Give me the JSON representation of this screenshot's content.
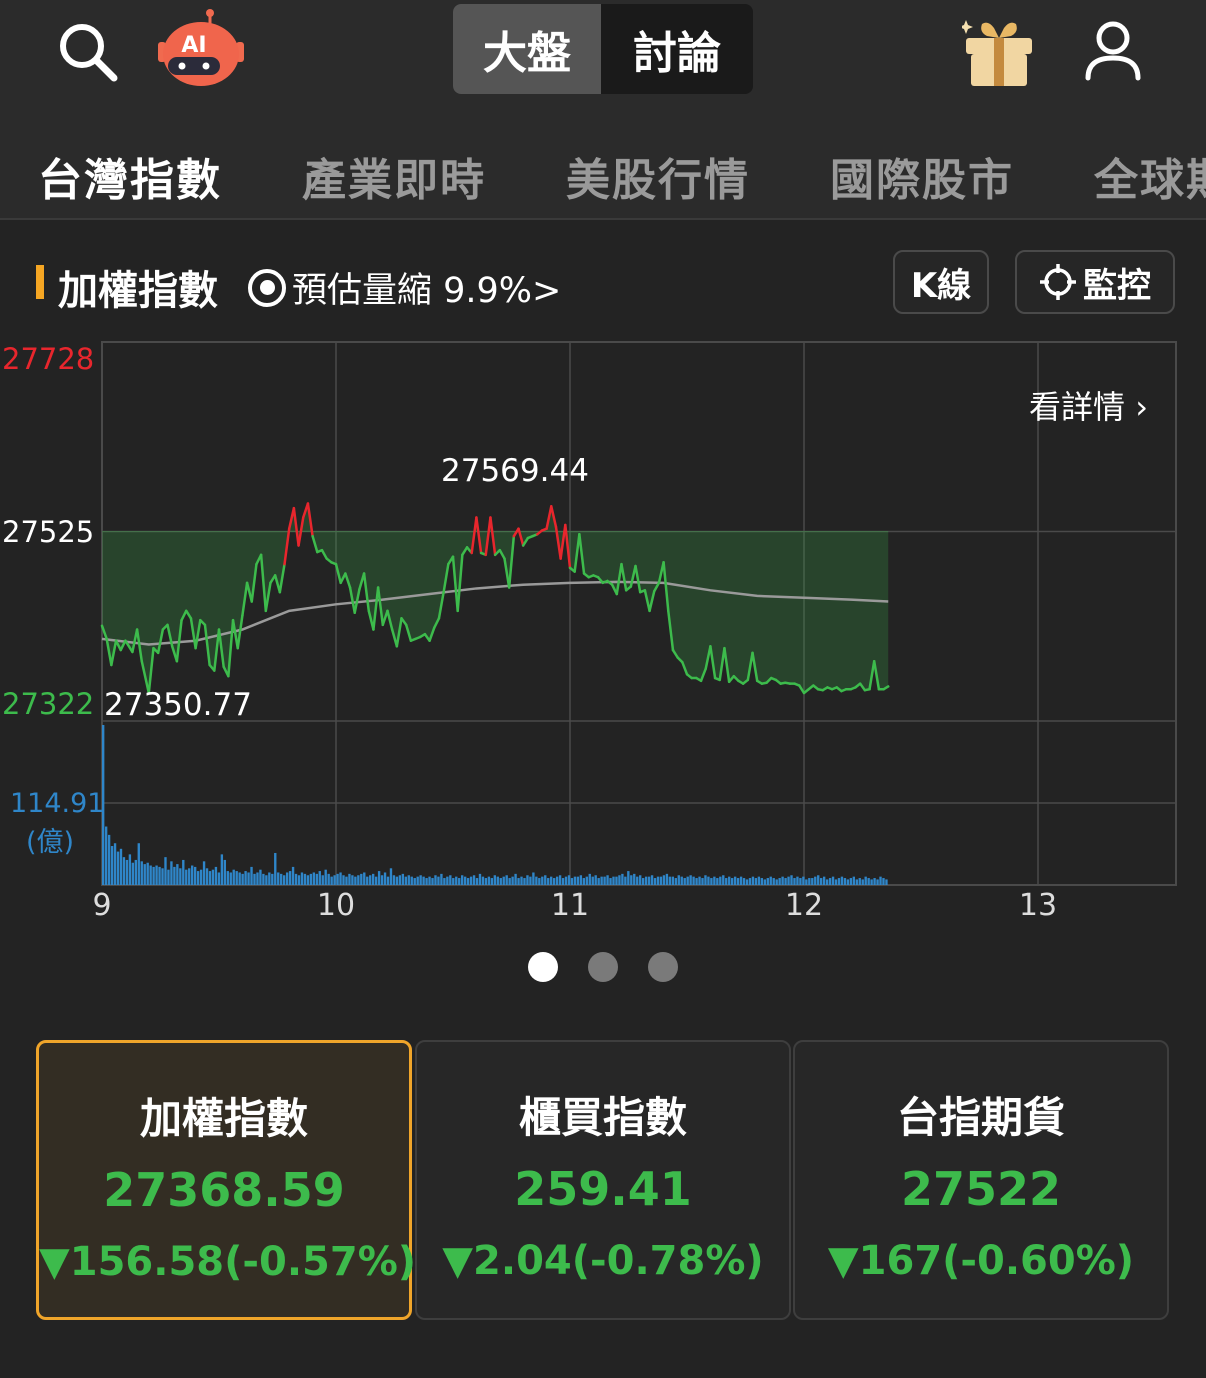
{
  "header": {
    "icons": {
      "search": "search-icon",
      "ai": "ai-robot-icon",
      "gift": "gift-icon",
      "user": "user-icon"
    },
    "ai_badge": "AI",
    "segment": {
      "active": "大盤",
      "inactive": "討論"
    }
  },
  "sub_nav": {
    "tabs": [
      "台灣指數",
      "產業即時",
      "美股行情",
      "國際股市",
      "全球期"
    ]
  },
  "index_header": {
    "title": "加權指數",
    "estimate": "預估量縮 9.9%>",
    "kline_button": "K線",
    "monitor_button": "監控"
  },
  "chart_labels": {
    "y_high": "27728",
    "y_ref": "27525",
    "y_low": "27322",
    "high_annotation": "27569.44",
    "low_annotation": "27350.77",
    "volume_max": "114.91",
    "volume_unit": "(億)",
    "detail_link": "看詳情 ›",
    "x_ticks": [
      "9",
      "10",
      "11",
      "12",
      "13"
    ]
  },
  "chart_data": {
    "type": "line",
    "ylim": [
      27322,
      27728
    ],
    "reference": 27525,
    "x_range": [
      9,
      13.5
    ],
    "price_points": [
      [
        9.0,
        27424
      ],
      [
        9.02,
        27410
      ],
      [
        9.04,
        27382
      ],
      [
        9.06,
        27408
      ],
      [
        9.08,
        27398
      ],
      [
        9.1,
        27408
      ],
      [
        9.13,
        27396
      ],
      [
        9.15,
        27420
      ],
      [
        9.17,
        27386
      ],
      [
        9.2,
        27352
      ],
      [
        9.22,
        27400
      ],
      [
        9.24,
        27395
      ],
      [
        9.26,
        27420
      ],
      [
        9.28,
        27425
      ],
      [
        9.3,
        27402
      ],
      [
        9.32,
        27386
      ],
      [
        9.34,
        27430
      ],
      [
        9.36,
        27440
      ],
      [
        9.38,
        27432
      ],
      [
        9.4,
        27400
      ],
      [
        9.42,
        27430
      ],
      [
        9.44,
        27425
      ],
      [
        9.46,
        27382
      ],
      [
        9.48,
        27376
      ],
      [
        9.5,
        27420
      ],
      [
        9.52,
        27380
      ],
      [
        9.54,
        27370
      ],
      [
        9.56,
        27430
      ],
      [
        9.58,
        27400
      ],
      [
        9.6,
        27435
      ],
      [
        9.62,
        27470
      ],
      [
        9.64,
        27450
      ],
      [
        9.66,
        27490
      ],
      [
        9.68,
        27500
      ],
      [
        9.7,
        27440
      ],
      [
        9.72,
        27470
      ],
      [
        9.74,
        27478
      ],
      [
        9.76,
        27460
      ],
      [
        9.78,
        27490
      ],
      [
        9.8,
        27528
      ],
      [
        9.82,
        27550
      ],
      [
        9.84,
        27510
      ],
      [
        9.86,
        27540
      ],
      [
        9.88,
        27555
      ],
      [
        9.9,
        27520
      ],
      [
        9.92,
        27503
      ],
      [
        9.94,
        27505
      ],
      [
        9.96,
        27496
      ],
      [
        9.98,
        27492
      ],
      [
        10.0,
        27490
      ],
      [
        10.02,
        27470
      ],
      [
        10.04,
        27480
      ],
      [
        10.06,
        27465
      ],
      [
        10.08,
        27438
      ],
      [
        10.1,
        27463
      ],
      [
        10.12,
        27480
      ],
      [
        10.14,
        27440
      ],
      [
        10.16,
        27420
      ],
      [
        10.18,
        27465
      ],
      [
        10.2,
        27425
      ],
      [
        10.22,
        27440
      ],
      [
        10.24,
        27420
      ],
      [
        10.26,
        27402
      ],
      [
        10.28,
        27432
      ],
      [
        10.3,
        27425
      ],
      [
        10.32,
        27408
      ],
      [
        10.34,
        27410
      ],
      [
        10.36,
        27412
      ],
      [
        10.38,
        27415
      ],
      [
        10.4,
        27408
      ],
      [
        10.42,
        27422
      ],
      [
        10.44,
        27432
      ],
      [
        10.46,
        27460
      ],
      [
        10.48,
        27490
      ],
      [
        10.5,
        27498
      ],
      [
        10.52,
        27440
      ],
      [
        10.54,
        27500
      ],
      [
        10.56,
        27508
      ],
      [
        10.58,
        27502
      ],
      [
        10.6,
        27540
      ],
      [
        10.62,
        27502
      ],
      [
        10.64,
        27500
      ],
      [
        10.66,
        27540
      ],
      [
        10.68,
        27500
      ],
      [
        10.7,
        27505
      ],
      [
        10.72,
        27496
      ],
      [
        10.74,
        27465
      ],
      [
        10.76,
        27520
      ],
      [
        10.78,
        27528
      ],
      [
        10.8,
        27510
      ],
      [
        10.82,
        27518
      ],
      [
        10.84,
        27520
      ],
      [
        10.86,
        27522
      ],
      [
        10.88,
        27526
      ],
      [
        10.9,
        27528
      ],
      [
        10.92,
        27552
      ],
      [
        10.94,
        27530
      ],
      [
        10.96,
        27496
      ],
      [
        10.98,
        27532
      ],
      [
        11.0,
        27486
      ],
      [
        11.02,
        27482
      ],
      [
        11.04,
        27522
      ],
      [
        11.06,
        27480
      ],
      [
        11.08,
        27476
      ],
      [
        11.1,
        27478
      ],
      [
        11.12,
        27476
      ],
      [
        11.14,
        27470
      ],
      [
        11.16,
        27472
      ],
      [
        11.18,
        27468
      ],
      [
        11.2,
        27458
      ],
      [
        11.22,
        27490
      ],
      [
        11.24,
        27462
      ],
      [
        11.26,
        27466
      ],
      [
        11.28,
        27488
      ],
      [
        11.3,
        27460
      ],
      [
        11.32,
        27462
      ],
      [
        11.34,
        27440
      ],
      [
        11.36,
        27461
      ],
      [
        11.38,
        27470
      ],
      [
        11.4,
        27492
      ],
      [
        11.42,
        27440
      ],
      [
        11.44,
        27398
      ],
      [
        11.46,
        27390
      ],
      [
        11.48,
        27385
      ],
      [
        11.5,
        27372
      ],
      [
        11.52,
        27368
      ],
      [
        11.54,
        27368
      ],
      [
        11.56,
        27365
      ],
      [
        11.58,
        27378
      ],
      [
        11.6,
        27402
      ],
      [
        11.62,
        27368
      ],
      [
        11.64,
        27366
      ],
      [
        11.66,
        27400
      ],
      [
        11.68,
        27364
      ],
      [
        11.7,
        27370
      ],
      [
        11.72,
        27365
      ],
      [
        11.74,
        27362
      ],
      [
        11.76,
        27366
      ],
      [
        11.78,
        27395
      ],
      [
        11.8,
        27365
      ],
      [
        11.82,
        27362
      ],
      [
        11.84,
        27363
      ],
      [
        11.86,
        27368
      ],
      [
        11.88,
        27366
      ],
      [
        11.9,
        27362
      ],
      [
        11.92,
        27363
      ],
      [
        11.94,
        27362
      ],
      [
        11.96,
        27362
      ],
      [
        11.98,
        27360
      ],
      [
        12.0,
        27352
      ],
      [
        12.02,
        27356
      ],
      [
        12.04,
        27360
      ],
      [
        12.06,
        27356
      ],
      [
        12.08,
        27355
      ],
      [
        12.1,
        27358
      ],
      [
        12.12,
        27356
      ],
      [
        12.14,
        27358
      ],
      [
        12.16,
        27354
      ],
      [
        12.18,
        27356
      ],
      [
        12.2,
        27356
      ],
      [
        12.22,
        27358
      ],
      [
        12.24,
        27362
      ],
      [
        12.26,
        27355
      ],
      [
        12.28,
        27356
      ],
      [
        12.3,
        27386
      ],
      [
        12.32,
        27356
      ],
      [
        12.34,
        27356
      ],
      [
        12.36,
        27359
      ]
    ],
    "avg_points": [
      [
        9.0,
        27410
      ],
      [
        9.2,
        27404
      ],
      [
        9.4,
        27408
      ],
      [
        9.6,
        27420
      ],
      [
        9.8,
        27440
      ],
      [
        10.0,
        27447
      ],
      [
        10.2,
        27452
      ],
      [
        10.4,
        27458
      ],
      [
        10.6,
        27464
      ],
      [
        10.8,
        27468
      ],
      [
        11.0,
        27470
      ],
      [
        11.2,
        27471
      ],
      [
        11.4,
        27470
      ],
      [
        11.6,
        27462
      ],
      [
        11.8,
        27456
      ],
      [
        12.0,
        27454
      ],
      [
        12.2,
        27452
      ],
      [
        12.36,
        27450
      ]
    ],
    "volume": [
      114.91,
      42,
      36,
      28,
      30,
      24,
      26,
      20,
      18,
      22,
      16,
      18,
      30,
      17,
      15,
      16,
      14,
      13,
      14,
      13,
      12,
      20,
      11,
      17,
      13,
      15,
      12,
      18,
      11,
      12,
      14,
      13,
      10,
      11,
      17,
      12,
      10,
      11,
      13,
      9,
      22,
      18,
      10,
      9,
      11,
      10,
      9,
      8,
      10,
      9,
      13,
      8,
      9,
      11,
      8,
      7,
      9,
      8,
      23,
      9,
      8,
      7,
      9,
      10,
      13,
      8,
      7,
      9,
      8,
      7,
      8,
      9,
      8,
      10,
      7,
      11,
      8,
      6,
      7,
      8,
      9,
      7,
      6,
      8,
      7,
      6,
      7,
      8,
      9,
      6,
      7,
      8,
      6,
      10,
      7,
      9,
      6,
      12,
      7,
      6,
      7,
      8,
      6,
      7,
      6,
      5,
      6,
      7,
      6,
      5,
      6,
      5,
      7,
      6,
      8,
      5,
      6,
      7,
      5,
      6,
      5,
      7,
      6,
      5,
      6,
      7,
      5,
      8,
      6,
      5,
      6,
      5,
      7,
      6,
      5,
      6,
      7,
      5,
      6,
      8,
      5,
      6,
      5,
      7,
      6,
      9,
      6,
      5,
      6,
      7,
      5,
      6,
      5,
      6,
      7,
      5,
      6,
      7,
      5,
      6,
      6,
      7,
      5,
      6,
      8,
      6,
      7,
      5,
      6,
      6,
      7,
      5,
      6,
      6,
      7,
      8,
      6,
      10,
      7,
      8,
      6,
      7,
      5,
      6,
      6,
      7,
      5,
      6,
      6,
      7,
      8,
      6,
      6,
      5,
      7,
      6,
      5,
      6,
      7,
      6,
      5,
      6,
      5,
      7,
      6,
      5,
      6,
      5,
      6,
      7,
      5,
      6,
      5,
      6,
      5,
      6,
      5,
      4,
      5,
      6,
      5,
      6,
      5,
      4,
      5,
      6,
      5,
      4,
      5,
      6,
      5,
      6,
      7,
      5,
      6,
      5,
      6,
      4,
      5,
      5,
      6,
      7,
      5,
      6,
      4,
      5,
      6,
      4,
      5,
      6,
      5,
      4,
      5,
      6,
      4,
      5,
      4,
      6,
      5,
      4,
      5,
      4,
      6,
      5,
      4
    ],
    "volume_max": 114.91,
    "volume_unit": "億",
    "x_ticks": [
      9,
      10,
      11,
      12,
      13
    ]
  },
  "pagination": {
    "count": 3,
    "active": 0
  },
  "cards": [
    {
      "name": "加權指數",
      "value": "27368.59",
      "change": "▼156.58(-0.57%)",
      "selected": true
    },
    {
      "name": "櫃買指數",
      "value": "259.41",
      "change": "▼2.04(-0.78%)",
      "selected": false
    },
    {
      "name": "台指期貨",
      "value": "27522",
      "change": "▼167(-0.60%)",
      "selected": false
    }
  ],
  "colors": {
    "up": "#e8262d",
    "down": "#3dbb4c",
    "volume": "#2f86c9",
    "accent": "#f5a623",
    "avg_line": "#9a9a9a"
  }
}
